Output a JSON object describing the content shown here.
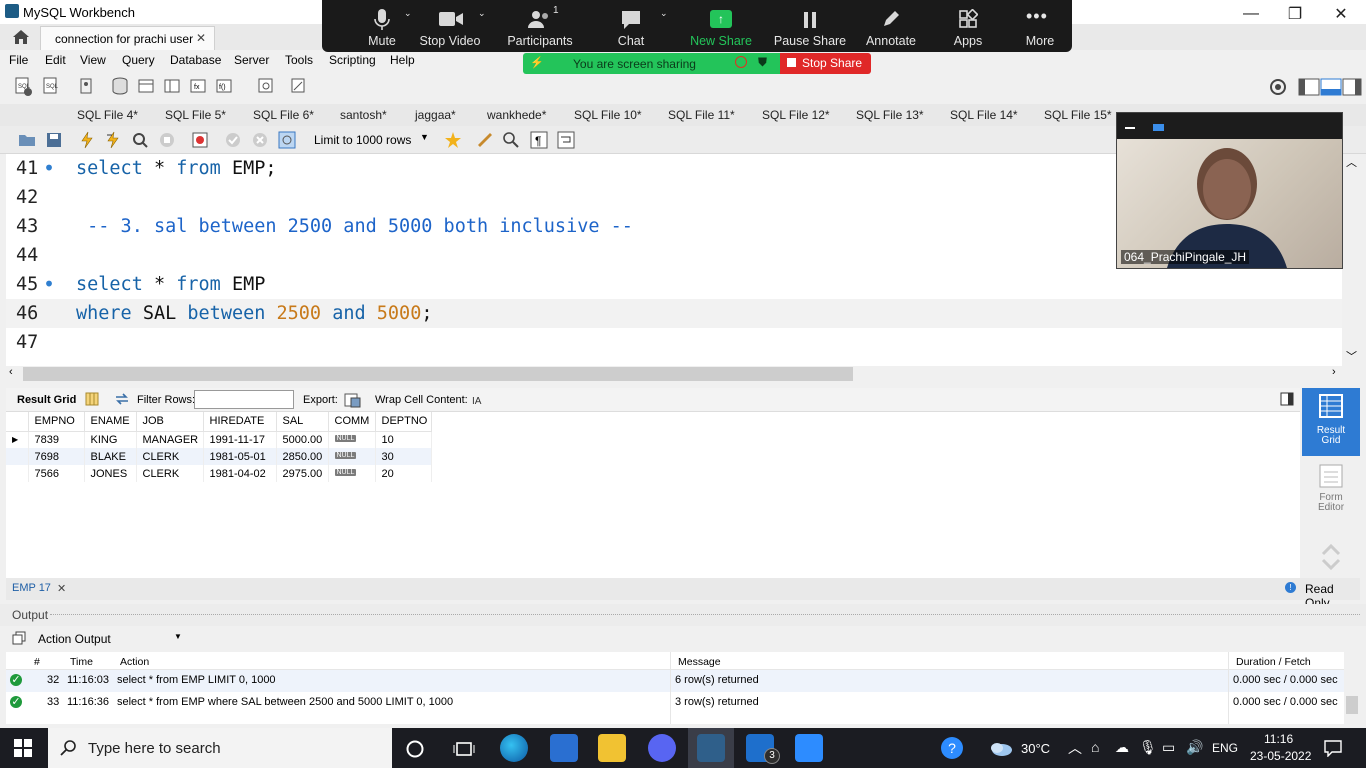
{
  "window": {
    "title": "MySQL Workbench",
    "controls": [
      "—",
      "❐",
      "✕"
    ]
  },
  "connection_tab": {
    "label": "connection for prachi user",
    "close": "✕"
  },
  "menu": [
    "File",
    "Edit",
    "View",
    "Query",
    "Database",
    "Server",
    "Tools",
    "Scripting",
    "Help"
  ],
  "sql_tabs": [
    "SQL File 4*",
    "SQL File 5*",
    "SQL File 6*",
    "santosh*",
    "jaggaa*",
    "wankhede*",
    "SQL File 10*",
    "SQL File 11*",
    "SQL File 12*",
    "SQL File 13*",
    "SQL File 14*",
    "SQL File 15*"
  ],
  "editor_toolbar": {
    "limit_label": "Limit to 1000 rows"
  },
  "editor": {
    "lines": [
      {
        "num": "41",
        "dot": "•",
        "text": "select * from EMP;"
      },
      {
        "num": "42",
        "dot": "",
        "text": ""
      },
      {
        "num": "43",
        "dot": "",
        "text": " -- 3. sal between 2500 and 5000 both inclusive --"
      },
      {
        "num": "44",
        "dot": "",
        "text": ""
      },
      {
        "num": "45",
        "dot": "•",
        "text": "select * from EMP"
      },
      {
        "num": "46",
        "dot": "",
        "text": "where SAL between 2500 and 5000;"
      },
      {
        "num": "47",
        "dot": "",
        "text": ""
      }
    ]
  },
  "result_toolbar": {
    "result_grid": "Result Grid",
    "filter_rows": "Filter Rows:",
    "export": "Export:",
    "wrap": "Wrap Cell Content:"
  },
  "result_grid": {
    "columns": [
      "EMPNO",
      "ENAME",
      "JOB",
      "HIREDATE",
      "SAL",
      "COMM",
      "DEPTNO"
    ],
    "rows": [
      [
        "7839",
        "KING",
        "MANAGER",
        "1991-11-17",
        "5000.00",
        "NULL",
        "10"
      ],
      [
        "7698",
        "BLAKE",
        "CLERK",
        "1981-05-01",
        "2850.00",
        "NULL",
        "30"
      ],
      [
        "7566",
        "JONES",
        "CLERK",
        "1981-04-02",
        "2975.00",
        "NULL",
        "20"
      ]
    ]
  },
  "side_panel": {
    "result_grid": "Result\nGrid",
    "form_editor": "Form\nEditor"
  },
  "result_tab": {
    "label": "EMP 17",
    "close": "✕",
    "read_only": "Read Only"
  },
  "output": {
    "label": "Output",
    "mode": "Action Output",
    "headers": [
      "#",
      "Time",
      "Action",
      "Message",
      "Duration / Fetch"
    ],
    "rows": [
      {
        "num": "32",
        "time": "11:16:03",
        "action": "select * from EMP LIMIT 0, 1000",
        "message": "6 row(s) returned",
        "duration": "0.000 sec / 0.000 sec"
      },
      {
        "num": "33",
        "time": "11:16:36",
        "action": "select * from EMP where SAL between 2500 and 5000 LIMIT 0, 1000",
        "message": "3 row(s) returned",
        "duration": "0.000 sec / 0.000 sec"
      }
    ]
  },
  "zoom": {
    "buttons": [
      "Mute",
      "Stop Video",
      "Participants",
      "Chat",
      "New Share",
      "Pause Share",
      "Annotate",
      "Apps",
      "More"
    ],
    "participants_count": "1",
    "sharing_text": "You are screen sharing",
    "stop_share": "Stop Share",
    "participant_name": "064_PrachiPingale_JH"
  },
  "taskbar": {
    "search_placeholder": "Type here to search",
    "weather": "30°C",
    "lang": "ENG",
    "time": "11:16",
    "date": "23-05-2022",
    "mail_badge": "3"
  }
}
